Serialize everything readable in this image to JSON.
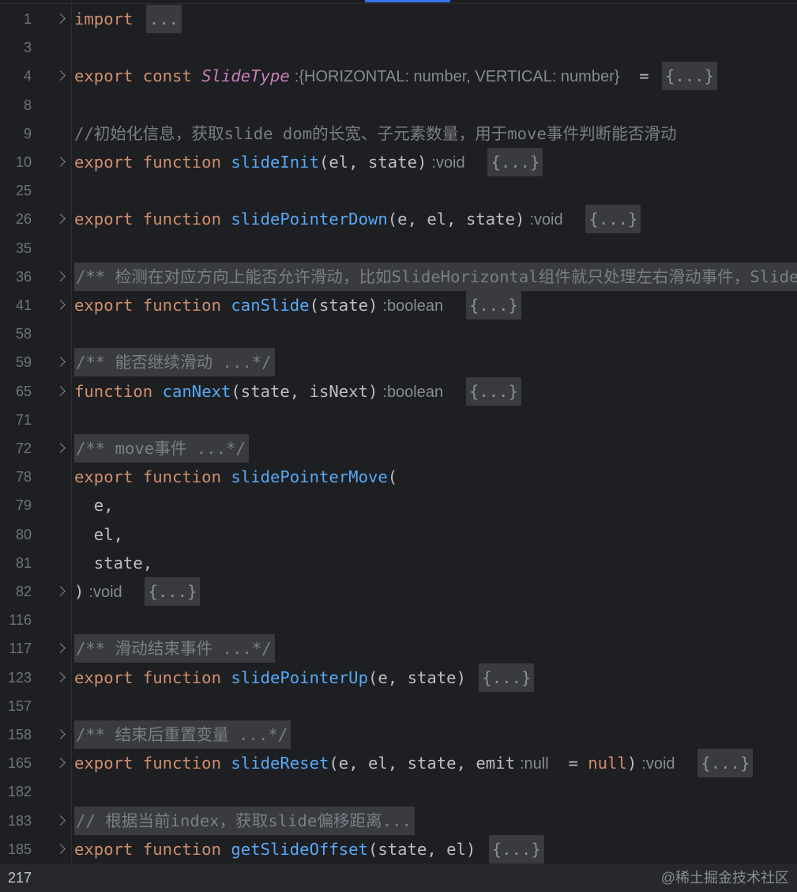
{
  "editor": {
    "current_line": "217",
    "lines": [
      {
        "n": "1",
        "fold": true,
        "tokens": [
          {
            "t": "kw",
            "v": "import"
          },
          {
            "t": "plain",
            "v": " "
          },
          {
            "t": "fold-box",
            "v": "..."
          }
        ]
      },
      {
        "n": "3",
        "fold": false,
        "tokens": []
      },
      {
        "n": "4",
        "fold": true,
        "tokens": [
          {
            "t": "kw",
            "v": "export const "
          },
          {
            "t": "cls",
            "v": "SlideType"
          },
          {
            "t": "hint-colon",
            "v": ":"
          },
          {
            "t": "hint",
            "v": "{HORIZONTAL: number, VERTICAL: number}"
          },
          {
            "t": "plain",
            "v": "  = "
          },
          {
            "t": "fold-box",
            "v": "{...}"
          }
        ]
      },
      {
        "n": "8",
        "fold": false,
        "tokens": []
      },
      {
        "n": "9",
        "fold": false,
        "tokens": [
          {
            "t": "cmt",
            "v": "//初始化信息，获取slide dom的长宽、子元素数量，用于move事件判断能否滑动"
          }
        ]
      },
      {
        "n": "10",
        "fold": true,
        "tokens": [
          {
            "t": "kw",
            "v": "export function "
          },
          {
            "t": "fn",
            "v": "slideInit"
          },
          {
            "t": "plain",
            "v": "(el, state)"
          },
          {
            "t": "hint-colon",
            "v": ":"
          },
          {
            "t": "hint",
            "v": "void"
          },
          {
            "t": "plain",
            "v": "  "
          },
          {
            "t": "fold-box",
            "v": "{...}"
          }
        ]
      },
      {
        "n": "25",
        "fold": false,
        "tokens": []
      },
      {
        "n": "26",
        "fold": true,
        "tokens": [
          {
            "t": "kw",
            "v": "export function "
          },
          {
            "t": "fn",
            "v": "slidePointerDown"
          },
          {
            "t": "plain",
            "v": "(e, el, state)"
          },
          {
            "t": "hint-colon",
            "v": ":"
          },
          {
            "t": "hint",
            "v": "void"
          },
          {
            "t": "plain",
            "v": "  "
          },
          {
            "t": "fold-box",
            "v": "{...}"
          }
        ]
      },
      {
        "n": "35",
        "fold": false,
        "tokens": []
      },
      {
        "n": "36",
        "fold": true,
        "tokens": [
          {
            "t": "cmt-bg",
            "v": "/** 检测在对应方向上能否允许滑动，比如SlideHorizontal组件就只处理左右滑动事件，Slide"
          }
        ]
      },
      {
        "n": "41",
        "fold": true,
        "tokens": [
          {
            "t": "kw",
            "v": "export function "
          },
          {
            "t": "fn",
            "v": "canSlide"
          },
          {
            "t": "plain",
            "v": "(state)"
          },
          {
            "t": "hint-colon",
            "v": ":"
          },
          {
            "t": "hint",
            "v": "boolean"
          },
          {
            "t": "plain",
            "v": "  "
          },
          {
            "t": "fold-box",
            "v": "{...}"
          }
        ]
      },
      {
        "n": "58",
        "fold": false,
        "tokens": []
      },
      {
        "n": "59",
        "fold": true,
        "tokens": [
          {
            "t": "cmt-bg",
            "v": "/** 能否继续滑动 ...*/"
          }
        ]
      },
      {
        "n": "65",
        "fold": true,
        "tokens": [
          {
            "t": "kw",
            "v": "function "
          },
          {
            "t": "fn",
            "v": "canNext"
          },
          {
            "t": "plain",
            "v": "(state, isNext)"
          },
          {
            "t": "hint-colon",
            "v": ":"
          },
          {
            "t": "hint",
            "v": "boolean"
          },
          {
            "t": "plain",
            "v": "  "
          },
          {
            "t": "fold-box",
            "v": "{...}"
          }
        ]
      },
      {
        "n": "71",
        "fold": false,
        "tokens": []
      },
      {
        "n": "72",
        "fold": true,
        "tokens": [
          {
            "t": "cmt-bg",
            "v": "/** move事件 ...*/"
          }
        ]
      },
      {
        "n": "78",
        "fold": false,
        "tokens": [
          {
            "t": "kw",
            "v": "export function "
          },
          {
            "t": "fn",
            "v": "slidePointerMove"
          },
          {
            "t": "plain",
            "v": "("
          }
        ]
      },
      {
        "n": "79",
        "fold": false,
        "tokens": [
          {
            "t": "plain",
            "v": "  e,"
          }
        ]
      },
      {
        "n": "80",
        "fold": false,
        "tokens": [
          {
            "t": "plain",
            "v": "  el,"
          }
        ]
      },
      {
        "n": "81",
        "fold": false,
        "tokens": [
          {
            "t": "plain",
            "v": "  state,"
          }
        ]
      },
      {
        "n": "82",
        "fold": true,
        "tokens": [
          {
            "t": "plain",
            "v": ")"
          },
          {
            "t": "hint-colon",
            "v": ":"
          },
          {
            "t": "hint",
            "v": "void"
          },
          {
            "t": "plain",
            "v": "  "
          },
          {
            "t": "fold-box",
            "v": "{...}"
          }
        ]
      },
      {
        "n": "116",
        "fold": false,
        "tokens": []
      },
      {
        "n": "117",
        "fold": true,
        "tokens": [
          {
            "t": "cmt-bg",
            "v": "/** 滑动结束事件 ...*/"
          }
        ]
      },
      {
        "n": "123",
        "fold": true,
        "tokens": [
          {
            "t": "kw",
            "v": "export function "
          },
          {
            "t": "fn",
            "v": "slidePointerUp"
          },
          {
            "t": "plain",
            "v": "(e, state) "
          },
          {
            "t": "fold-box",
            "v": "{...}"
          }
        ]
      },
      {
        "n": "157",
        "fold": false,
        "tokens": []
      },
      {
        "n": "158",
        "fold": true,
        "tokens": [
          {
            "t": "cmt-bg",
            "v": "/** 结束后重置变量 ...*/"
          }
        ]
      },
      {
        "n": "165",
        "fold": true,
        "tokens": [
          {
            "t": "kw",
            "v": "export function "
          },
          {
            "t": "fn",
            "v": "slideReset"
          },
          {
            "t": "plain",
            "v": "(e, el, state, emit"
          },
          {
            "t": "hint-colon",
            "v": ":"
          },
          {
            "t": "hint",
            "v": "null"
          },
          {
            "t": "plain",
            "v": "  = "
          },
          {
            "t": "kw",
            "v": "null"
          },
          {
            "t": "plain",
            "v": ")"
          },
          {
            "t": "hint-colon",
            "v": ":"
          },
          {
            "t": "hint",
            "v": "void"
          },
          {
            "t": "plain",
            "v": "  "
          },
          {
            "t": "fold-box",
            "v": "{...}"
          }
        ]
      },
      {
        "n": "182",
        "fold": false,
        "tokens": []
      },
      {
        "n": "183",
        "fold": true,
        "tokens": [
          {
            "t": "cmt-bg",
            "v": "// 根据当前index，获取slide偏移距离..."
          }
        ]
      },
      {
        "n": "185",
        "fold": true,
        "tokens": [
          {
            "t": "kw",
            "v": "export function "
          },
          {
            "t": "fn",
            "v": "getSlideOffset"
          },
          {
            "t": "plain",
            "v": "(state, el) "
          },
          {
            "t": "fold-box",
            "v": "{...}"
          }
        ]
      },
      {
        "n": "217",
        "fold": false,
        "tokens": []
      }
    ]
  },
  "watermark": "@稀土掘金技术社区"
}
